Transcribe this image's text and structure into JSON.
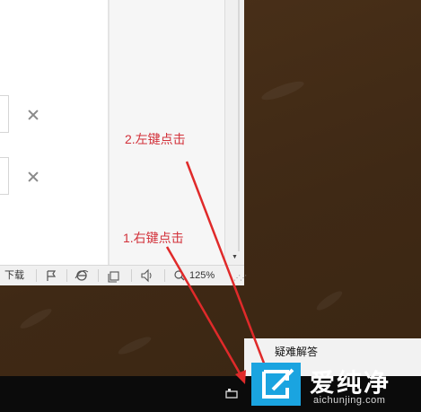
{
  "statusbar": {
    "download_label": "下载",
    "zoom_label": "125%"
  },
  "annotations": {
    "step2": "2.左键点击",
    "step1": "1.右键点击"
  },
  "tray_popup": {
    "menu_item_label": "疑难解答"
  },
  "watermark": {
    "cn_text": "爱纯净",
    "en_text": "aichunjing.com"
  },
  "colors": {
    "desktop": "#442c18",
    "annotation": "#d2313a",
    "taskbar": "#0b0b0b",
    "watermark_blue": "#1aa4e0"
  }
}
